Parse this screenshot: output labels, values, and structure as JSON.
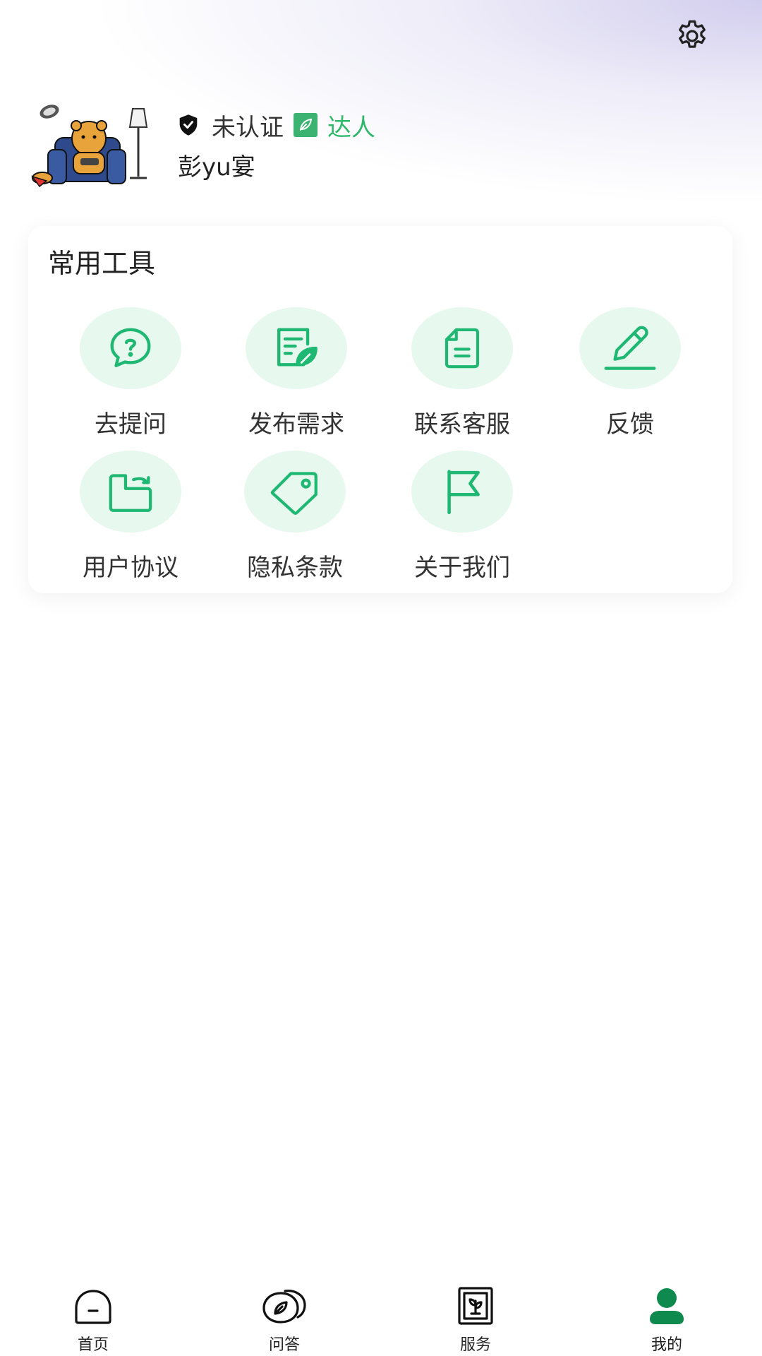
{
  "header": {
    "settings_icon": "gear-icon"
  },
  "profile": {
    "avatar_icon": "avatar-cartoon-bear-on-sofa",
    "certification_status": "未认证",
    "certification_icon": "shield-icon",
    "expert_label": "达人",
    "expert_icon": "leaf-badge-icon",
    "username": "彭yu宴",
    "colors": {
      "expert": "#2fb86a"
    }
  },
  "tools": {
    "title": "常用工具",
    "items": [
      {
        "label": "去提问",
        "icon": "question-bubble-icon"
      },
      {
        "label": "发布需求",
        "icon": "document-leaf-icon"
      },
      {
        "label": "联系客服",
        "icon": "file-icon"
      },
      {
        "label": "反馈",
        "icon": "pencil-icon"
      },
      {
        "label": "用户协议",
        "icon": "folder-export-icon"
      },
      {
        "label": "隐私条款",
        "icon": "tag-icon"
      },
      {
        "label": "关于我们",
        "icon": "flag-icon"
      }
    ],
    "colors": {
      "icon": "#1fb873",
      "circle": "#e7f8ef"
    }
  },
  "bottom_nav": {
    "items": [
      {
        "label": "首页",
        "icon": "home-icon",
        "active": false
      },
      {
        "label": "问答",
        "icon": "chat-leaf-icon",
        "active": false
      },
      {
        "label": "服务",
        "icon": "book-plant-icon",
        "active": false
      },
      {
        "label": "我的",
        "icon": "user-icon",
        "active": true
      }
    ],
    "colors": {
      "active": "#0f8a4f",
      "inactive": "#222222"
    }
  }
}
